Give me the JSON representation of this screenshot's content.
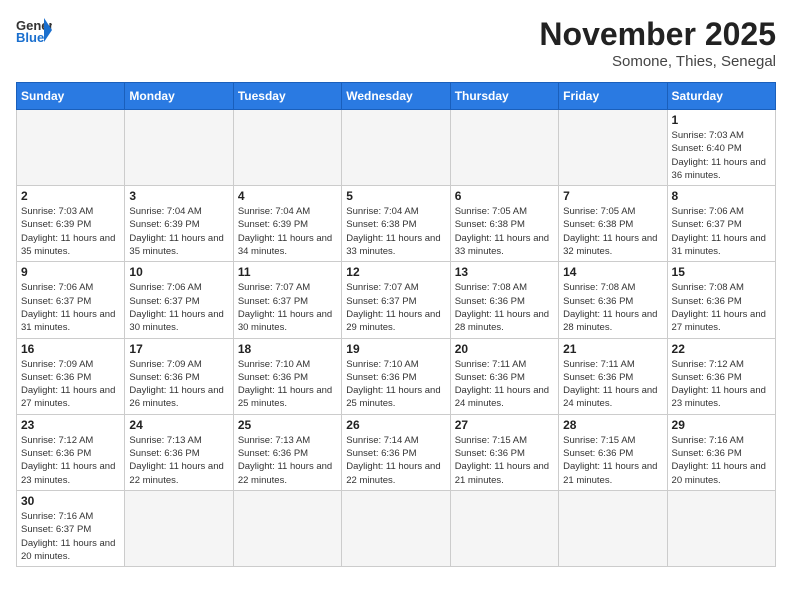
{
  "header": {
    "logo_general": "General",
    "logo_blue": "Blue",
    "month_title": "November 2025",
    "location": "Somone, Thies, Senegal"
  },
  "days_of_week": [
    "Sunday",
    "Monday",
    "Tuesday",
    "Wednesday",
    "Thursday",
    "Friday",
    "Saturday"
  ],
  "weeks": [
    [
      {
        "day": "",
        "info": ""
      },
      {
        "day": "",
        "info": ""
      },
      {
        "day": "",
        "info": ""
      },
      {
        "day": "",
        "info": ""
      },
      {
        "day": "",
        "info": ""
      },
      {
        "day": "",
        "info": ""
      },
      {
        "day": "1",
        "info": "Sunrise: 7:03 AM\nSunset: 6:40 PM\nDaylight: 11 hours and 36 minutes."
      }
    ],
    [
      {
        "day": "2",
        "info": "Sunrise: 7:03 AM\nSunset: 6:39 PM\nDaylight: 11 hours and 35 minutes."
      },
      {
        "day": "3",
        "info": "Sunrise: 7:04 AM\nSunset: 6:39 PM\nDaylight: 11 hours and 35 minutes."
      },
      {
        "day": "4",
        "info": "Sunrise: 7:04 AM\nSunset: 6:39 PM\nDaylight: 11 hours and 34 minutes."
      },
      {
        "day": "5",
        "info": "Sunrise: 7:04 AM\nSunset: 6:38 PM\nDaylight: 11 hours and 33 minutes."
      },
      {
        "day": "6",
        "info": "Sunrise: 7:05 AM\nSunset: 6:38 PM\nDaylight: 11 hours and 33 minutes."
      },
      {
        "day": "7",
        "info": "Sunrise: 7:05 AM\nSunset: 6:38 PM\nDaylight: 11 hours and 32 minutes."
      },
      {
        "day": "8",
        "info": "Sunrise: 7:06 AM\nSunset: 6:37 PM\nDaylight: 11 hours and 31 minutes."
      }
    ],
    [
      {
        "day": "9",
        "info": "Sunrise: 7:06 AM\nSunset: 6:37 PM\nDaylight: 11 hours and 31 minutes."
      },
      {
        "day": "10",
        "info": "Sunrise: 7:06 AM\nSunset: 6:37 PM\nDaylight: 11 hours and 30 minutes."
      },
      {
        "day": "11",
        "info": "Sunrise: 7:07 AM\nSunset: 6:37 PM\nDaylight: 11 hours and 30 minutes."
      },
      {
        "day": "12",
        "info": "Sunrise: 7:07 AM\nSunset: 6:37 PM\nDaylight: 11 hours and 29 minutes."
      },
      {
        "day": "13",
        "info": "Sunrise: 7:08 AM\nSunset: 6:36 PM\nDaylight: 11 hours and 28 minutes."
      },
      {
        "day": "14",
        "info": "Sunrise: 7:08 AM\nSunset: 6:36 PM\nDaylight: 11 hours and 28 minutes."
      },
      {
        "day": "15",
        "info": "Sunrise: 7:08 AM\nSunset: 6:36 PM\nDaylight: 11 hours and 27 minutes."
      }
    ],
    [
      {
        "day": "16",
        "info": "Sunrise: 7:09 AM\nSunset: 6:36 PM\nDaylight: 11 hours and 27 minutes."
      },
      {
        "day": "17",
        "info": "Sunrise: 7:09 AM\nSunset: 6:36 PM\nDaylight: 11 hours and 26 minutes."
      },
      {
        "day": "18",
        "info": "Sunrise: 7:10 AM\nSunset: 6:36 PM\nDaylight: 11 hours and 25 minutes."
      },
      {
        "day": "19",
        "info": "Sunrise: 7:10 AM\nSunset: 6:36 PM\nDaylight: 11 hours and 25 minutes."
      },
      {
        "day": "20",
        "info": "Sunrise: 7:11 AM\nSunset: 6:36 PM\nDaylight: 11 hours and 24 minutes."
      },
      {
        "day": "21",
        "info": "Sunrise: 7:11 AM\nSunset: 6:36 PM\nDaylight: 11 hours and 24 minutes."
      },
      {
        "day": "22",
        "info": "Sunrise: 7:12 AM\nSunset: 6:36 PM\nDaylight: 11 hours and 23 minutes."
      }
    ],
    [
      {
        "day": "23",
        "info": "Sunrise: 7:12 AM\nSunset: 6:36 PM\nDaylight: 11 hours and 23 minutes."
      },
      {
        "day": "24",
        "info": "Sunrise: 7:13 AM\nSunset: 6:36 PM\nDaylight: 11 hours and 22 minutes."
      },
      {
        "day": "25",
        "info": "Sunrise: 7:13 AM\nSunset: 6:36 PM\nDaylight: 11 hours and 22 minutes."
      },
      {
        "day": "26",
        "info": "Sunrise: 7:14 AM\nSunset: 6:36 PM\nDaylight: 11 hours and 22 minutes."
      },
      {
        "day": "27",
        "info": "Sunrise: 7:15 AM\nSunset: 6:36 PM\nDaylight: 11 hours and 21 minutes."
      },
      {
        "day": "28",
        "info": "Sunrise: 7:15 AM\nSunset: 6:36 PM\nDaylight: 11 hours and 21 minutes."
      },
      {
        "day": "29",
        "info": "Sunrise: 7:16 AM\nSunset: 6:36 PM\nDaylight: 11 hours and 20 minutes."
      }
    ],
    [
      {
        "day": "30",
        "info": "Sunrise: 7:16 AM\nSunset: 6:37 PM\nDaylight: 11 hours and 20 minutes."
      },
      {
        "day": "",
        "info": ""
      },
      {
        "day": "",
        "info": ""
      },
      {
        "day": "",
        "info": ""
      },
      {
        "day": "",
        "info": ""
      },
      {
        "day": "",
        "info": ""
      },
      {
        "day": "",
        "info": ""
      }
    ]
  ]
}
